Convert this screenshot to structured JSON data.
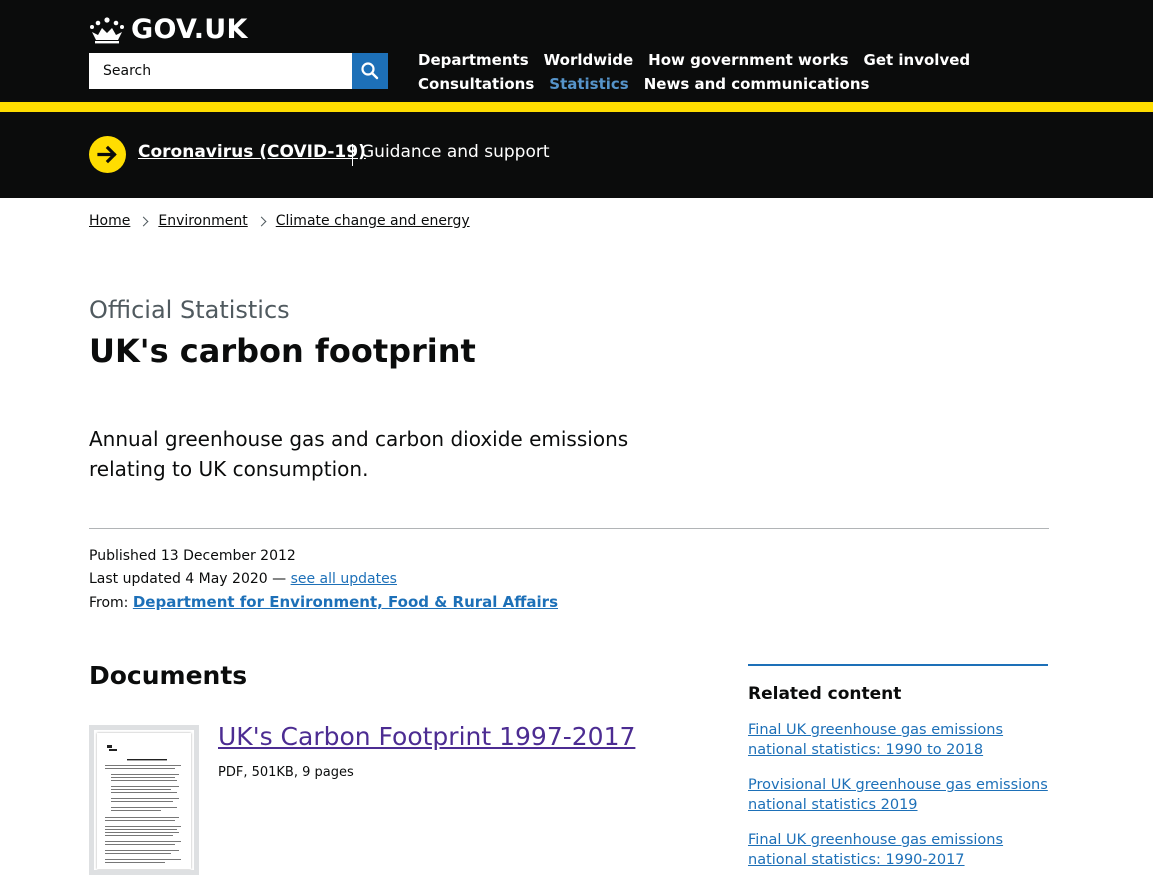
{
  "header": {
    "logo_text": "GOV.UK",
    "search_placeholder": "Search",
    "nav_row1": [
      "Departments",
      "Worldwide",
      "How government works",
      "Get involved"
    ],
    "nav_row2": [
      "Consultations",
      "Statistics",
      "News and communications"
    ],
    "active_nav": "Statistics"
  },
  "covid_banner": {
    "link": "Coronavirus (COVID-19)",
    "text": "Guidance and support"
  },
  "breadcrumb": [
    "Home",
    "Environment",
    "Climate change and energy"
  ],
  "page": {
    "caption": "Official Statistics",
    "title": "UK's carbon footprint",
    "lead": "Annual greenhouse gas and carbon dioxide emissions relating to UK consumption."
  },
  "metadata": {
    "published_label": "Published",
    "published_date": "13 December 2012",
    "updated_label": "Last updated",
    "updated_date": "4 May 2020",
    "updates_sep": "—",
    "see_all_updates": "see all updates",
    "from_label": "From:",
    "organisation": "Department for Environment, Food & Rural Affairs"
  },
  "documents": {
    "heading": "Documents",
    "items": [
      {
        "title": "UK's Carbon Footprint 1997-2017",
        "meta": "PDF, 501KB, 9 pages"
      }
    ]
  },
  "related": {
    "heading": "Related content",
    "links": [
      "Final UK greenhouse gas emissions national statistics: 1990 to 2018",
      "Provisional UK greenhouse gas emissions national statistics 2019",
      "Final UK greenhouse gas emissions national statistics: 1990-2017"
    ]
  },
  "colors": {
    "black": "#0b0c0c",
    "yellow": "#ffdd00",
    "link_blue": "#1d70b8",
    "active_nav": "#5694ca",
    "visited_purple": "#4c2c92",
    "secondary_text": "#505a5f"
  }
}
